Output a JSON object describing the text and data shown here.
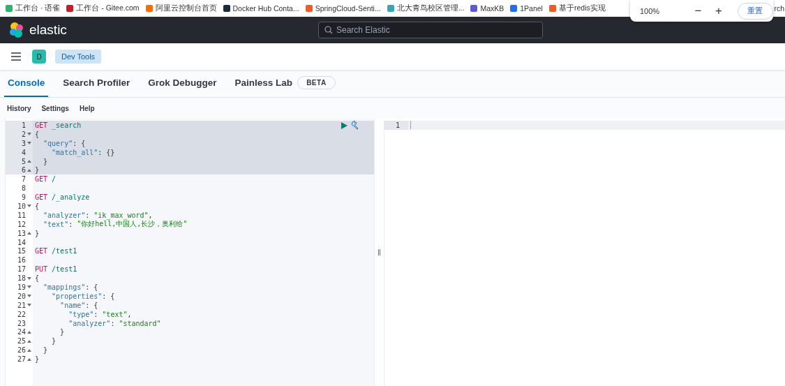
{
  "bookmarks": [
    {
      "label": "工作台 · 语雀",
      "color": "#2fb36b"
    },
    {
      "label": "工作台 - Gitee.com",
      "color": "#c71d23"
    },
    {
      "label": "阿里云控制台首页",
      "color": "#ff6a00"
    },
    {
      "label": "Docker Hub Conta...",
      "color": "#1d2a3a"
    },
    {
      "label": "SpringCloud-Senti...",
      "color": "#f05a28"
    },
    {
      "label": "北大青鸟校区管理...",
      "color": "#3aa6b9"
    },
    {
      "label": "MaxKB",
      "color": "#5b5bd6"
    },
    {
      "label": "1Panel",
      "color": "#1f6feb"
    },
    {
      "label": "基于redis实现",
      "color": "#f05a28"
    }
  ],
  "bookmark_tail": "rch",
  "zoom_popup": {
    "value": "100%",
    "minus": "−",
    "plus": "+",
    "reset": "重置"
  },
  "header": {
    "logo": "elastic",
    "search": {
      "placeholder": "Search Elastic"
    }
  },
  "breadcrumb": {
    "avatar": "D",
    "crumb": "Dev Tools"
  },
  "tabs": [
    {
      "label": "Console",
      "selected": true
    },
    {
      "label": "Search Profiler",
      "selected": false
    },
    {
      "label": "Grok Debugger",
      "selected": false
    },
    {
      "label": "Painless Lab",
      "selected": false,
      "badge": "BETA"
    }
  ],
  "menu": [
    "History",
    "Settings",
    "Help"
  ],
  "editor": {
    "lines": [
      {
        "n": "1",
        "selected": true,
        "tokens": [
          {
            "t": "GET",
            "kind": "method"
          },
          {
            "t": " _search",
            "kind": "url"
          }
        ]
      },
      {
        "n": "2",
        "selected": true,
        "fold_start": true,
        "tokens": [
          {
            "t": "{",
            "kind": "punct"
          }
        ]
      },
      {
        "n": "3",
        "selected": true,
        "fold_start": true,
        "tokens": [
          {
            "t": "  \"query\"",
            "kind": "key"
          },
          {
            "t": ": {",
            "kind": "punct"
          }
        ]
      },
      {
        "n": "4",
        "selected": true,
        "tokens": [
          {
            "t": "    \"match_all\"",
            "kind": "key"
          },
          {
            "t": ": {}",
            "kind": "punct"
          }
        ]
      },
      {
        "n": "5",
        "selected": true,
        "fold_start": false,
        "tokens": [
          {
            "t": "  }",
            "kind": "punct"
          }
        ]
      },
      {
        "n": "6",
        "selected": true,
        "fold_start": false,
        "tokens": [
          {
            "t": "}",
            "kind": "punct"
          }
        ]
      },
      {
        "n": "7",
        "selected": false,
        "tokens": [
          {
            "t": "GET",
            "kind": "method"
          },
          {
            "t": " /",
            "kind": "url"
          }
        ]
      },
      {
        "n": "8",
        "selected": false
      },
      {
        "n": "9",
        "selected": false,
        "tokens": [
          {
            "t": "GET",
            "kind": "method"
          },
          {
            "t": " /_analyze",
            "kind": "url"
          }
        ]
      },
      {
        "n": "10",
        "selected": false,
        "fold_start": true,
        "tokens": [
          {
            "t": "{",
            "kind": "punct"
          }
        ]
      },
      {
        "n": "11",
        "selected": false,
        "tokens": [
          {
            "t": "  \"analyzer\"",
            "kind": "key"
          },
          {
            "t": ": ",
            "kind": "punct"
          },
          {
            "t": "\"ik_max_word\"",
            "kind": "string"
          },
          {
            "t": ",",
            "kind": "punct"
          }
        ]
      },
      {
        "n": "12",
        "selected": false,
        "tokens": [
          {
            "t": "  \"text\"",
            "kind": "key"
          },
          {
            "t": ": ",
            "kind": "punct"
          },
          {
            "t": "\"你好hell,中国人,长沙，奥利给\"",
            "kind": "string"
          }
        ]
      },
      {
        "n": "13",
        "selected": false,
        "fold_start": false,
        "tokens": [
          {
            "t": "}",
            "kind": "punct"
          }
        ]
      },
      {
        "n": "14",
        "selected": false
      },
      {
        "n": "15",
        "selected": false,
        "tokens": [
          {
            "t": "GET",
            "kind": "method"
          },
          {
            "t": " /test1",
            "kind": "url"
          }
        ]
      },
      {
        "n": "16",
        "selected": false
      },
      {
        "n": "17",
        "selected": false,
        "tokens": [
          {
            "t": "PUT",
            "kind": "method"
          },
          {
            "t": " /test1",
            "kind": "url"
          }
        ]
      },
      {
        "n": "18",
        "selected": false,
        "fold_start": true,
        "tokens": [
          {
            "t": "{",
            "kind": "punct"
          }
        ]
      },
      {
        "n": "19",
        "selected": false,
        "fold_start": true,
        "tokens": [
          {
            "t": "  \"mappings\"",
            "kind": "key"
          },
          {
            "t": ": {",
            "kind": "punct"
          }
        ]
      },
      {
        "n": "20",
        "selected": false,
        "fold_start": true,
        "tokens": [
          {
            "t": "    \"properties\"",
            "kind": "key"
          },
          {
            "t": ": {",
            "kind": "punct"
          }
        ]
      },
      {
        "n": "21",
        "selected": false,
        "fold_start": true,
        "tokens": [
          {
            "t": "      \"name\"",
            "kind": "key"
          },
          {
            "t": ": {",
            "kind": "punct"
          }
        ]
      },
      {
        "n": "22",
        "selected": false,
        "tokens": [
          {
            "t": "        \"type\"",
            "kind": "key"
          },
          {
            "t": ": ",
            "kind": "punct"
          },
          {
            "t": "\"text\"",
            "kind": "string"
          },
          {
            "t": ",",
            "kind": "punct"
          }
        ]
      },
      {
        "n": "23",
        "selected": false,
        "tokens": [
          {
            "t": "        \"analyzer\"",
            "kind": "key"
          },
          {
            "t": ": ",
            "kind": "punct"
          },
          {
            "t": "\"standard\"",
            "kind": "string"
          }
        ]
      },
      {
        "n": "24",
        "selected": false,
        "fold_start": false,
        "tokens": [
          {
            "t": "      }",
            "kind": "punct"
          }
        ]
      },
      {
        "n": "25",
        "selected": false,
        "fold_start": false,
        "tokens": [
          {
            "t": "    }",
            "kind": "punct"
          }
        ]
      },
      {
        "n": "26",
        "selected": false,
        "fold_start": false,
        "tokens": [
          {
            "t": "  }",
            "kind": "punct"
          }
        ]
      },
      {
        "n": "27",
        "selected": false,
        "fold_start": false,
        "tokens": [
          {
            "t": "}",
            "kind": "punct"
          }
        ]
      }
    ]
  },
  "output": {
    "lines": [
      "1"
    ]
  }
}
